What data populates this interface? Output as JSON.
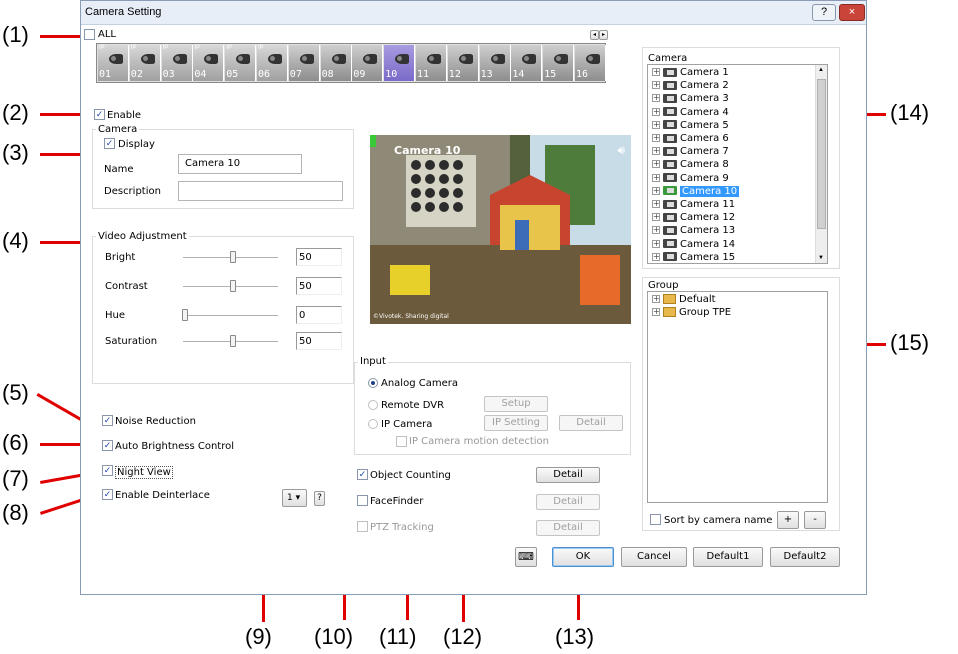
{
  "window": {
    "title": "Camera Setting",
    "help_label": "?",
    "close_label": "×"
  },
  "callouts": [
    "(1)",
    "(2)",
    "(3)",
    "(4)",
    "(5)",
    "(6)",
    "(7)",
    "(8)",
    "(9)",
    "(10)",
    "(11)",
    "(12)",
    "(13)",
    "(14)",
    "(15)"
  ],
  "all_label": "ALL",
  "camera_strip": {
    "cameras": [
      {
        "num": "01",
        "type": "IP"
      },
      {
        "num": "02",
        "type": "IP"
      },
      {
        "num": "03",
        "type": "IP"
      },
      {
        "num": "04",
        "type": "IP"
      },
      {
        "num": "05",
        "type": "IP"
      },
      {
        "num": "06",
        "type": "IP"
      },
      {
        "num": "07",
        "type": "analog"
      },
      {
        "num": "08",
        "type": "analog"
      },
      {
        "num": "09",
        "type": "analog"
      },
      {
        "num": "10",
        "type": "analog",
        "selected": true
      },
      {
        "num": "11",
        "type": "analog"
      },
      {
        "num": "12",
        "type": "analog"
      },
      {
        "num": "13",
        "type": "analog"
      },
      {
        "num": "14",
        "type": "analog"
      },
      {
        "num": "15",
        "type": "analog"
      },
      {
        "num": "16",
        "type": "analog"
      }
    ],
    "ip_tag": "IP"
  },
  "enable_label": "Enable",
  "camera_group": {
    "title": "Camera",
    "display_label": "Display",
    "name_label": "Name",
    "name_value": "Camera 10",
    "description_label": "Description",
    "description_value": ""
  },
  "video_adjustment": {
    "title": "Video Adjustment",
    "rows": [
      {
        "label": "Bright",
        "value": "50",
        "level": 0.5
      },
      {
        "label": "Contrast",
        "value": "50",
        "level": 0.5
      },
      {
        "label": "Hue",
        "value": "0",
        "level": 0
      },
      {
        "label": "Saturation",
        "value": "50",
        "level": 0.5
      }
    ]
  },
  "checks": {
    "noise_reduction": "Noise Reduction",
    "auto_brightness": "Auto Brightness Control",
    "night_view": "Night View",
    "deinterlace": "Enable Deinterlace",
    "object_counting": "Object Counting",
    "facefinder": "FaceFinder",
    "ptz_tracking": "PTZ Tracking"
  },
  "deinterlace_select": "1",
  "question_label": "?",
  "preview": {
    "label": "Camera 10",
    "watermark": "©Vivotek. Sharing digital"
  },
  "input": {
    "title": "Input",
    "analog": "Analog Camera",
    "remote_dvr": "Remote DVR",
    "ip_camera": "IP Camera",
    "ip_motion": "IP Camera motion detection",
    "setup": "Setup",
    "ip_setting": "IP Setting",
    "detail": "Detail"
  },
  "detail_buttons": [
    "Detail",
    "Detail",
    "Detail"
  ],
  "camera_tree": {
    "title": "Camera",
    "items": [
      "Camera 1",
      "Camera 2",
      "Camera 3",
      "Camera 4",
      "Camera 5",
      "Camera 6",
      "Camera 7",
      "Camera 8",
      "Camera 9",
      "Camera 10",
      "Camera 11",
      "Camera 12",
      "Camera 13",
      "Camera 14",
      "Camera 15"
    ],
    "selected_index": 9
  },
  "group_tree": {
    "title": "Group",
    "items": [
      "Defualt",
      "Group TPE"
    ]
  },
  "sort_label": "Sort by camera name",
  "plus_label": "+",
  "minus_label": "-",
  "bottom_buttons": {
    "ok": "OK",
    "cancel": "Cancel",
    "default1": "Default1",
    "default2": "Default2"
  }
}
